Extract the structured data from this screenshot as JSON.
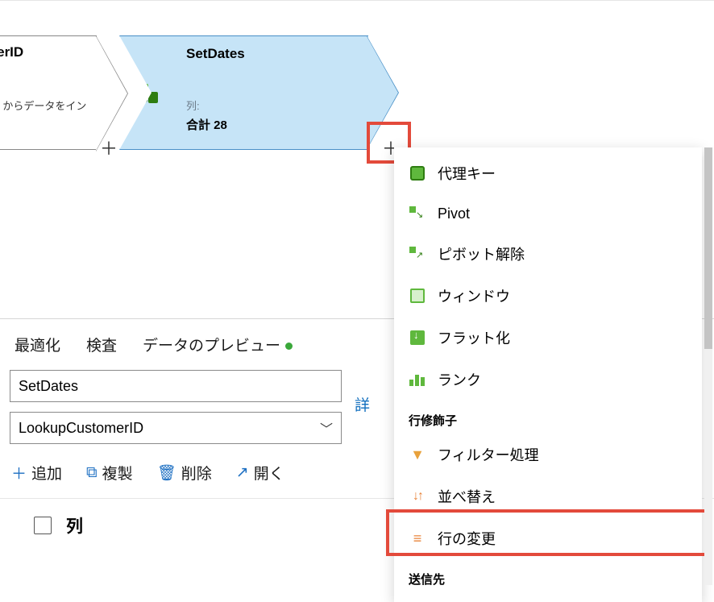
{
  "nodes": {
    "left": {
      "title_fragment": "merID",
      "desc_fragment": "ner からデータをイン"
    },
    "setdates": {
      "title": "SetDates",
      "cols_label": "列:",
      "total": "合計 28"
    }
  },
  "tabs": {
    "optimize": "最適化",
    "inspect": "検査",
    "preview": "データのプレビュー"
  },
  "inputs": {
    "name_value": "SetDates",
    "stream_value": "LookupCustomerID",
    "details": "詳"
  },
  "actions": {
    "add": "追加",
    "copy": "複製",
    "delete": "削除",
    "open": "開く"
  },
  "columns_header": "列",
  "menu": {
    "surrogate_key": "代理キー",
    "pivot": "Pivot",
    "unpivot": "ピボット解除",
    "window": "ウィンドウ",
    "flatten": "フラット化",
    "rank": "ランク",
    "section_row": "行修飾子",
    "filter": "フィルター処理",
    "sort": "並べ替え",
    "alter_row": "行の変更",
    "section_dest": "送信先"
  }
}
